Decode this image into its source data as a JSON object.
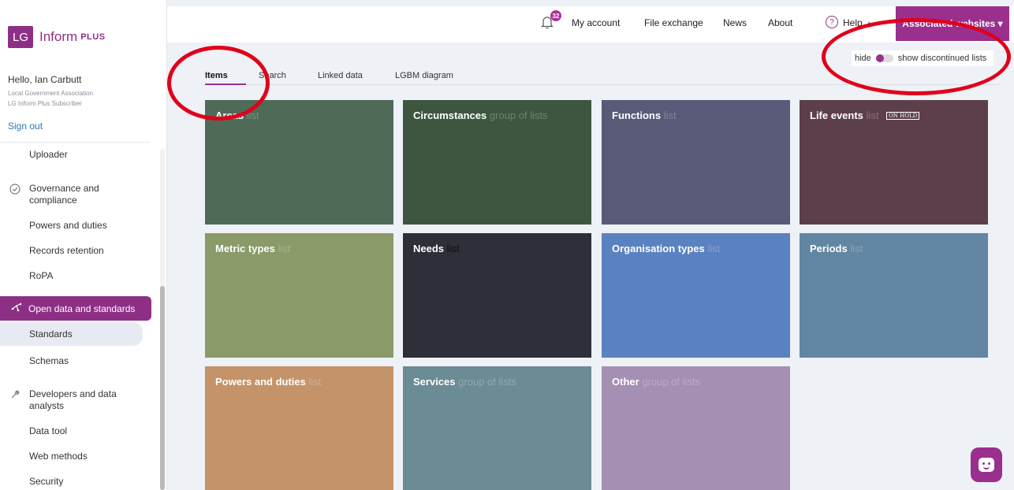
{
  "logo": {
    "badge": "LG",
    "name": "Inform",
    "plus": "PLUS"
  },
  "user": {
    "greeting": "Hello, Ian Carbutt",
    "organisation": "Local Government Association",
    "role": "LG Inform Plus Subscriber",
    "sign_out": "Sign out"
  },
  "sidebar": {
    "items": [
      {
        "label": "Uploader"
      },
      {
        "label": "Governance and compliance",
        "icon": "check-circle-icon"
      },
      {
        "label": "Powers and duties"
      },
      {
        "label": "Records retention"
      },
      {
        "label": "RoPA"
      },
      {
        "label": "Open data and standards",
        "icon": "network-icon"
      },
      {
        "label": "Standards"
      },
      {
        "label": "Schemas"
      },
      {
        "label": "Developers and data analysts",
        "icon": "wrench-icon"
      },
      {
        "label": "Data tool"
      },
      {
        "label": "Web methods"
      },
      {
        "label": "Security"
      }
    ]
  },
  "topbar": {
    "notification_count": "32",
    "my_account": "My account",
    "file_exchange": "File exchange",
    "news": "News",
    "about": "About",
    "help": "Help",
    "associated_websites": "Associated websites ▾"
  },
  "toggle": {
    "hide": "hide",
    "show": "show discontinued lists"
  },
  "tabs": [
    {
      "label": "Items"
    },
    {
      "label": "Search"
    },
    {
      "label": "Linked data"
    },
    {
      "label": "LGBM diagram"
    }
  ],
  "tiles": [
    {
      "title": "Areas",
      "kind": "list",
      "color": "#4e6b58"
    },
    {
      "title": "Circumstances",
      "kind": "group of lists",
      "color": "#3e5640"
    },
    {
      "title": "Functions",
      "kind": "list",
      "color": "#585a78"
    },
    {
      "title": "Life events",
      "kind": "list",
      "color": "#5d3f4c",
      "badge": "ON HOLD"
    },
    {
      "title": "Metric types",
      "kind": "list",
      "color": "#8a9a68"
    },
    {
      "title": "Needs",
      "kind": "list",
      "color": "#2d3038"
    },
    {
      "title": "Organisation types",
      "kind": "list",
      "color": "#5b82c0"
    },
    {
      "title": "Periods",
      "kind": "list",
      "color": "#6286a2"
    },
    {
      "title": "Powers and duties",
      "kind": "list",
      "color": "#c4936a"
    },
    {
      "title": "Services",
      "kind": "group of lists",
      "color": "#6b8b95"
    },
    {
      "title": "Other",
      "kind": "group of lists",
      "color": "#a58fb3"
    }
  ],
  "colors": {
    "brand": "#9b2f8e",
    "annotation": "#e0001b"
  }
}
